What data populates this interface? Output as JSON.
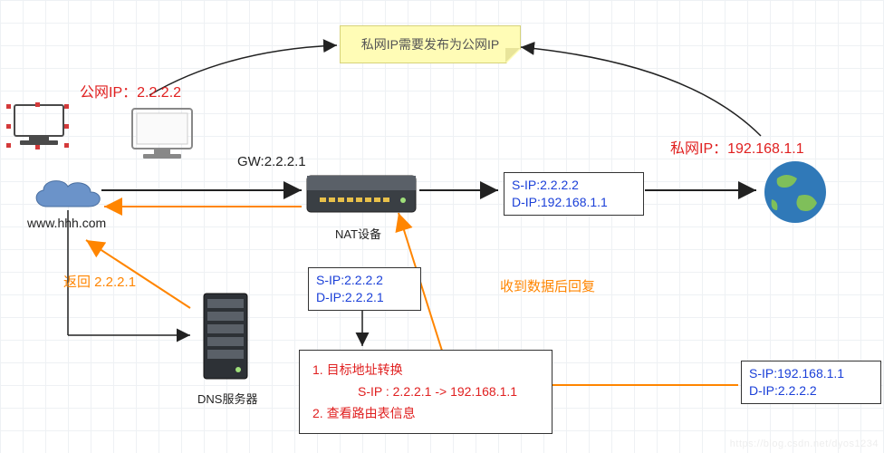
{
  "sticky_note": "私网IP需要发布为公网IP",
  "labels": {
    "public_ip": "公网IP：2.2.2.2",
    "private_ip": "私网IP：192.168.1.1",
    "gateway": "GW:2.2.2.1",
    "domain": "www.hhh.com",
    "nat_device": "NAT设备",
    "dns_server": "DNS服务器",
    "dns_return": "返回 2.2.2.1",
    "reply_after_data": "收到数据后回复"
  },
  "ip_box_outgoing": {
    "line1": "S-IP:2.2.2.2",
    "line2": "D-IP:192.168.1.1"
  },
  "ip_box_to_gw": {
    "line1": "S-IP:2.2.2.2",
    "line2": "D-IP:2.2.2.1"
  },
  "ip_box_reply": {
    "line1": "S-IP:192.168.1.1",
    "line2": "D-IP:2.2.2.2"
  },
  "steps": {
    "line1": "1. 目标地址转换",
    "line2": "S-IP : 2.2.2.1 -> 192.168.1.1",
    "line3": "2. 查看路由表信息"
  },
  "icons": {
    "pc": "client-pc",
    "cloud": "cloud",
    "router": "nat-router",
    "server": "dns-server",
    "globe": "internet-globe"
  },
  "watermark": "https://blog.csdn.net/dyos1234"
}
